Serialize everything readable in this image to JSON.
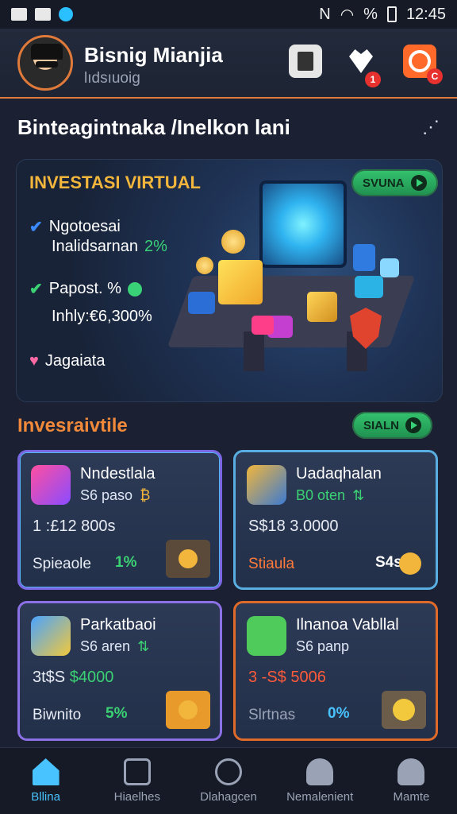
{
  "status_bar": {
    "time": "12:45",
    "percent": "%"
  },
  "header": {
    "user_name": "Bisnig Mianjia",
    "user_handle": "lıdsıuoig",
    "badge_heart": "1",
    "badge_q": "C"
  },
  "section": {
    "title": "Binteagintnaka /Inelkon lani"
  },
  "hero": {
    "title": "INVESTASI VIRTUAL",
    "button": "SVUNA",
    "feature1_line1": "Ngotoesai",
    "feature1_line2": "Inalidsarnan",
    "feature1_pct": "2%",
    "feature2_line1": "Papost. %",
    "feature2_line2": "Inhly:€6,300%",
    "feature3": "Jagaiata"
  },
  "subsection": {
    "title": "Invesraivtile",
    "button": "SIALN"
  },
  "cards": [
    {
      "name": "Nndestlala",
      "tag": "S6 paso",
      "tag_accent": "₿",
      "value": "1 :£12 800s",
      "label": "Spieaole",
      "pct": "1%",
      "pct_color": "#3bd274",
      "icon": "music-icon"
    },
    {
      "name": "Uadaqhalan",
      "tag": "B0 oten",
      "tag_accent": "⇅",
      "value": "S$18 3.0000",
      "label": "Stiaula",
      "pct": "S4s",
      "pct_color": "#ffffff",
      "icon": "board-icon"
    },
    {
      "name": "Parkatbaoi",
      "tag": "S6 aren",
      "tag_accent": "⇅",
      "value": "3t$S",
      "value_green": "$4000",
      "label": "Biwnito",
      "pct": "5%",
      "pct_color": "#3bd274",
      "icon": "note-icon"
    },
    {
      "name": "Ilnanoa Vabllal",
      "tag": "S6 panp",
      "tag_accent": "",
      "value": "3 -S$ 5006",
      "label": "Slrtnas",
      "pct": "0%",
      "pct_color": "#49c3ff",
      "icon": "cat-icon"
    }
  ],
  "nav": [
    {
      "label": "Bllina",
      "icon": "home-icon"
    },
    {
      "label": "Hiaelhes",
      "icon": "bolt-icon"
    },
    {
      "label": "Dlahagcen",
      "icon": "compass-icon"
    },
    {
      "label": "Nemalenient",
      "icon": "people-icon"
    },
    {
      "label": "Mamte",
      "icon": "person-icon"
    }
  ],
  "colors": {
    "accent_orange": "#e07a3a",
    "accent_green": "#3bd274",
    "accent_blue": "#49c3ff",
    "gold_title": "#f2b63c"
  }
}
